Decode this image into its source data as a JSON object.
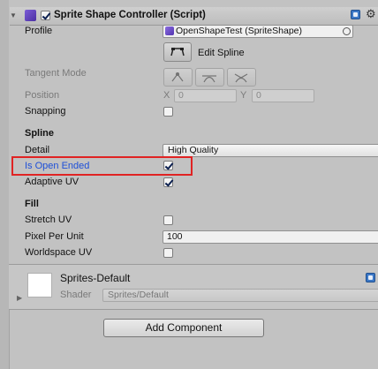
{
  "component": {
    "title": "Sprite Shape Controller (Script)",
    "enabled": true
  },
  "profile": {
    "label": "Profile",
    "value": "OpenShapeTest (SpriteShape)"
  },
  "edit_spline": {
    "label": "Edit Spline"
  },
  "tangent_mode": {
    "label": "Tangent Mode"
  },
  "position": {
    "label": "Position",
    "x_label": "X",
    "x_value": "0",
    "y_label": "Y",
    "y_value": "0"
  },
  "snapping": {
    "label": "Snapping",
    "checked": false
  },
  "spline_section": {
    "title": "Spline",
    "detail_label": "Detail",
    "detail_value": "High Quality",
    "open_ended_label": "Is Open Ended",
    "open_ended_checked": true,
    "adaptive_uv_label": "Adaptive UV",
    "adaptive_uv_checked": true
  },
  "fill_section": {
    "title": "Fill",
    "stretch_uv_label": "Stretch UV",
    "stretch_uv_checked": false,
    "pixel_per_unit_label": "Pixel Per Unit",
    "pixel_per_unit_value": "100",
    "worldspace_uv_label": "Worldspace UV",
    "worldspace_uv_checked": false
  },
  "material": {
    "name": "Sprites-Default",
    "shader_label": "Shader",
    "shader_value": "Sprites/Default"
  },
  "add_component_label": "Add Component",
  "colors": {
    "highlight": "#e02323",
    "highlighted_label": "#1d4fd8"
  }
}
